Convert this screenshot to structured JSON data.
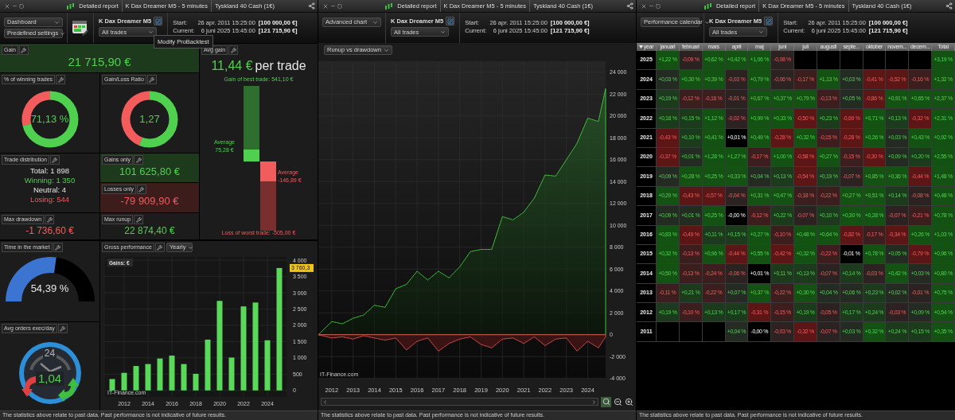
{
  "panels": [
    {
      "tabs": [
        "Detailed report",
        "K Dax Dreamer M5 - 5 minutes",
        "Tyskland 40 Cash (1€)"
      ],
      "view_select": "Dashboard",
      "settings_select": "Predefined settings",
      "system_name": "K Dax Dreamer M5",
      "trades_select": "All trades",
      "start_label": "Start:",
      "start_date": "26 apr. 2011 15:25:00",
      "start_capital": "[100 000,00 €]",
      "current_label": "Current:",
      "current_date": "6 juni 2025 15:45:00",
      "current_capital": "[121 715,90 €]",
      "footer": "The statistics above relate to past data. Past performance is not indicative of future results."
    },
    {
      "tabs": [
        "Detailed report",
        "K Dax Dreamer M5 - 5 minutes",
        "Tyskland 40 Cash (1€)"
      ],
      "view_select": "Advanced chart",
      "system_name": "K Dax Dreamer M5",
      "trades_select": "All trades",
      "start_label": "Start:",
      "start_date": "26 apr. 2011 15:25:00",
      "start_capital": "[100 000,00 €]",
      "current_label": "Current:",
      "current_date": "6 juni 2025 15:45:00",
      "current_capital": "[121 715,90 €]",
      "footer": "The statistics above relate to past data. Past performance is not indicative of future results."
    },
    {
      "tabs": [
        "Detailed report",
        "K Dax Dreamer M5 - 5 minutes",
        "Tyskland 40 Cash (1€)"
      ],
      "view_select": "Performance calendar",
      "system_name": "K Dax Dreamer M5",
      "trades_select": "All trades",
      "start_label": "Start:",
      "start_date": "26 apr. 2011 15:25:00",
      "start_capital": "[100 000,00 €]",
      "current_label": "Current:",
      "current_date": "6 juni 2025 15:45:00",
      "current_capital": "[121 715,90 €]",
      "footer": "The statistics above relate to past data. Past performance is not indicative of future results."
    }
  ],
  "dashboard": {
    "tooltip": "Modify ProBacktest",
    "gain": {
      "title": "Gain",
      "value": "21 715,90 €"
    },
    "avg_gain": {
      "title": "Avg gain",
      "value": "11,44 €",
      "unit": "per trade",
      "best_label": "Gain of best trade: 541,10 €",
      "avg_gain_label": "Average",
      "avg_gain_value": "75,28 €",
      "avg_loss_label": "Average",
      "avg_loss_value": "-146,89 €",
      "worst_label": "Loss of worst trade: -505,00 €"
    },
    "winning": {
      "title": "% of winning trades",
      "value": "71,13 %",
      "level": 0.7113
    },
    "ratio": {
      "title": "Gain/Loss Ratio",
      "value": "1,27",
      "level": 0.56
    },
    "distribution": {
      "title": "Trade distribution",
      "lines": [
        {
          "text": "Total: 1 898",
          "kind": "total"
        },
        {
          "text": "Winning: 1 350",
          "kind": "win"
        },
        {
          "text": "Neutral: 4",
          "kind": "neutral"
        },
        {
          "text": "Losing: 544",
          "kind": "loss"
        }
      ]
    },
    "gains_only": {
      "title": "Gains only",
      "value": "101 625,80 €"
    },
    "losses_only": {
      "title": "Losses only",
      "value": "-79 909,90 €"
    },
    "max_drawdown": {
      "title": "Max drawdown",
      "value": "-1 736,60 €"
    },
    "max_runup": {
      "title": "Max runup",
      "value": "22 874,40 €"
    },
    "time_in_market": {
      "title": "Time in the market",
      "value": "54,39 %",
      "level": 0.5439
    },
    "avg_orders": {
      "title": "Avg orders exec/day",
      "dial": "24",
      "value": "1,04"
    },
    "gross": {
      "title": "Gross performance",
      "period": "Yearly",
      "legend": "Gains: €",
      "marker": "3 760,3",
      "credit": "IT-Finance.com",
      "chart_data": {
        "type": "bar",
        "x": [
          2011,
          2012,
          2013,
          2014,
          2015,
          2016,
          2017,
          2018,
          2019,
          2020,
          2021,
          2022,
          2023,
          2024,
          2025
        ],
        "series": [
          {
            "color": "#5ad85a",
            "values": [
              350,
              540,
              750,
              810,
              980,
              1070,
              810,
              510,
              1560,
              2750,
              1010,
              2580,
              2700,
              1540,
              3760
            ]
          }
        ],
        "ylim": [
          -200,
          4100
        ],
        "xlim": [
          2010.4,
          2025.6
        ],
        "grid": true,
        "xticks": [
          2012,
          2014,
          2016,
          2018,
          2020,
          2022,
          2024
        ],
        "yticks": [
          {
            "value": 0,
            "label": "0"
          },
          {
            "value": 500,
            "label": "500"
          },
          {
            "value": 1000,
            "label": "1 000"
          },
          {
            "value": 1500,
            "label": "1 500"
          },
          {
            "value": 2000,
            "label": "2 000"
          },
          {
            "value": 2500,
            "label": "2 500"
          },
          {
            "value": 3000,
            "label": "3 000"
          },
          {
            "value": 3500,
            "label": "3 500"
          },
          {
            "value": 4000,
            "label": "4 000"
          }
        ]
      }
    }
  },
  "advanced_chart": {
    "chart_select": "Runup vs drawdown",
    "credit": "IT-Finance.com",
    "chart_data": {
      "type": "area",
      "x": [
        2011.37,
        2012,
        2012.5,
        2013,
        2013.5,
        2014,
        2014.5,
        2015,
        2015.5,
        2016,
        2016.5,
        2017,
        2017.5,
        2018,
        2018.5,
        2019,
        2019.5,
        2020,
        2020.5,
        2021,
        2021.5,
        2022,
        2022.5,
        2023,
        2023.5,
        2024,
        2024.5,
        2024.84
      ],
      "series": [
        {
          "color": "#3fbf3f",
          "values": [
            0,
            1200,
            1000,
            1500,
            1800,
            2700,
            2500,
            4200,
            4600,
            5800,
            5000,
            5800,
            5200,
            6200,
            7600,
            7800,
            7800,
            10800,
            10500,
            11200,
            12500,
            14600,
            14500,
            16000,
            17500,
            19800,
            19500,
            22500
          ]
        },
        {
          "color": "#d94a4a",
          "values": [
            0,
            -300,
            -200,
            -400,
            -100,
            -300,
            -500,
            -300,
            -1400,
            -600,
            -300,
            -1500,
            -800,
            -400,
            -200,
            -900,
            -1200,
            -400,
            -300,
            -800,
            -200,
            -1000,
            -400,
            -300,
            -1500,
            -600,
            -1200,
            -200
          ]
        }
      ],
      "xlim": [
        2011.37,
        2024.84
      ],
      "ylim": [
        -4000,
        25000
      ],
      "grid": true,
      "xticks": [
        2012,
        2013,
        2014,
        2015,
        2016,
        2017,
        2018,
        2019,
        2020,
        2021,
        2022,
        2023,
        2024
      ],
      "yticks": [
        {
          "value": -4000,
          "label": "-4 000"
        },
        {
          "value": -2000,
          "label": "-2 000"
        },
        {
          "value": 0,
          "label": "0"
        },
        {
          "value": 2000,
          "label": "2 000"
        },
        {
          "value": 4000,
          "label": "4 000"
        },
        {
          "value": 6000,
          "label": "6 000"
        },
        {
          "value": 8000,
          "label": "8 000"
        },
        {
          "value": 10000,
          "label": "10 000"
        },
        {
          "value": 12000,
          "label": "12 000"
        },
        {
          "value": 14000,
          "label": "14 000"
        },
        {
          "value": 16000,
          "label": "16 000"
        },
        {
          "value": 18000,
          "label": "18 000"
        },
        {
          "value": 20000,
          "label": "20 000"
        },
        {
          "value": 22000,
          "label": "22 000"
        },
        {
          "value": 24000,
          "label": "24 000"
        }
      ]
    }
  },
  "calendar": {
    "columns": [
      "year",
      "januari",
      "februari",
      "mars",
      "april",
      "maj",
      "juni",
      "juli",
      "augusti",
      "septe...",
      "oktober",
      "novem...",
      "decem...",
      "Total"
    ],
    "rows": [
      {
        "cells": [
          {
            "text": "2025"
          },
          {
            "text": "+1,22 %",
            "color": "#145214"
          },
          {
            "text": "-0,09 %",
            "color": "#2c2222"
          },
          {
            "text": "+0,62 %",
            "color": "#145214"
          },
          {
            "text": "+0,42 %",
            "color": "#145214"
          },
          {
            "text": "+1,06 %",
            "color": "#145214"
          },
          {
            "text": "-0,08 %",
            "color": "#2c2222"
          },
          {
            "color": "#000000"
          },
          {
            "color": "#000000"
          },
          {
            "color": "#000000"
          },
          {
            "color": "#000000"
          },
          {
            "color": "#000000"
          },
          {
            "color": "#000000"
          },
          {
            "text": "+3,19 %",
            "color": "#145214"
          }
        ]
      },
      {
        "cells": [
          {
            "text": "2024"
          },
          {
            "text": "+0,03 %",
            "color": "#232b23"
          },
          {
            "text": "+0,30 %",
            "color": "#145214"
          },
          {
            "text": "+0,39 %",
            "color": "#145214"
          },
          {
            "text": "-0,03 %",
            "color": "#2c2222"
          },
          {
            "text": "+0,79 %",
            "color": "#145214"
          },
          {
            "text": "-0,06 %",
            "color": "#2c2222"
          },
          {
            "text": "-0,17 %",
            "color": "#3d1e1e"
          },
          {
            "text": "+1,13 %",
            "color": "#145214"
          },
          {
            "text": "+0,03 %",
            "color": "#232b23"
          },
          {
            "text": "-0,41 %",
            "color": "#5c1616"
          },
          {
            "text": "-0,52 %",
            "color": "#5c1616"
          },
          {
            "text": "-0,16 %",
            "color": "#3d1e1e"
          },
          {
            "text": "+1,32 %",
            "color": "#145214"
          }
        ]
      },
      {
        "cells": [
          {
            "text": "2023"
          },
          {
            "text": "+0,19 %",
            "color": "#1c3a1c"
          },
          {
            "text": "-0,12 %",
            "color": "#3d1e1e"
          },
          {
            "text": "-0,16 %",
            "color": "#3d1e1e"
          },
          {
            "text": "-0,01 %",
            "color": "#2c2222"
          },
          {
            "text": "+0,67 %",
            "color": "#145214"
          },
          {
            "text": "+0,37 %",
            "color": "#145214"
          },
          {
            "text": "+0,79 %",
            "color": "#145214"
          },
          {
            "text": "-0,13 %",
            "color": "#3d1e1e"
          },
          {
            "text": "+0,05 %",
            "color": "#232b23"
          },
          {
            "text": "-0,86 %",
            "color": "#5c1616"
          },
          {
            "text": "+0,91 %",
            "color": "#145214"
          },
          {
            "text": "+0,65 %",
            "color": "#145214"
          },
          {
            "text": "+2,37 %",
            "color": "#145214"
          }
        ]
      },
      {
        "cells": [
          {
            "text": "2022"
          },
          {
            "text": "+0,18 %",
            "color": "#1c3a1c"
          },
          {
            "text": "+0,15 %",
            "color": "#1c3a1c"
          },
          {
            "text": "+1,12 %",
            "color": "#145214"
          },
          {
            "text": "-0,02 %",
            "color": "#2c2222"
          },
          {
            "text": "+0,99 %",
            "color": "#145214"
          },
          {
            "text": "+0,33 %",
            "color": "#145214"
          },
          {
            "text": "-0,50 %",
            "color": "#5c1616"
          },
          {
            "text": "+0,23 %",
            "color": "#1c3a1c"
          },
          {
            "text": "-0,69 %",
            "color": "#5c1616"
          },
          {
            "text": "+0,71 %",
            "color": "#145214"
          },
          {
            "text": "+0,13 %",
            "color": "#1c3a1c"
          },
          {
            "text": "-0,32 %",
            "color": "#5c1616"
          },
          {
            "text": "+2,31 %",
            "color": "#145214"
          }
        ]
      },
      {
        "cells": [
          {
            "text": "2021"
          },
          {
            "text": "-0,43 %",
            "color": "#5c1616"
          },
          {
            "text": "+0,10 %",
            "color": "#1c3a1c"
          },
          {
            "text": "+0,41 %",
            "color": "#145214"
          },
          {
            "text": "+0,01 %",
            "color": "#000000"
          },
          {
            "text": "+0,49 %",
            "color": "#145214"
          },
          {
            "text": "-0,28 %",
            "color": "#5c1616"
          },
          {
            "text": "+0,32 %",
            "color": "#145214"
          },
          {
            "text": "-0,15 %",
            "color": "#3d1e1e"
          },
          {
            "text": "-0,28 %",
            "color": "#5c1616"
          },
          {
            "text": "+0,26 %",
            "color": "#145214"
          },
          {
            "text": "+0,03 %",
            "color": "#232b23"
          },
          {
            "text": "+0,43 %",
            "color": "#145214"
          },
          {
            "text": "+0,92 %",
            "color": "#145214"
          }
        ]
      },
      {
        "cells": [
          {
            "text": "2020"
          },
          {
            "text": "-0,37 %",
            "color": "#5c1616"
          },
          {
            "text": "+0,01 %",
            "color": "#232b23"
          },
          {
            "text": "+1,28 %",
            "color": "#145214"
          },
          {
            "text": "+1,27 %",
            "color": "#145214"
          },
          {
            "text": "-0,17 %",
            "color": "#3d1e1e"
          },
          {
            "text": "+1,00 %",
            "color": "#145214"
          },
          {
            "text": "-0,58 %",
            "color": "#5c1616"
          },
          {
            "text": "+0,27 %",
            "color": "#145214"
          },
          {
            "text": "-0,15 %",
            "color": "#3d1e1e"
          },
          {
            "text": "-0,30 %",
            "color": "#5c1616"
          },
          {
            "text": "+0,09 %",
            "color": "#232b23"
          },
          {
            "text": "+0,20 %",
            "color": "#1c3a1c"
          },
          {
            "text": "+2,55 %",
            "color": "#145214"
          }
        ]
      },
      {
        "cells": [
          {
            "text": "2019"
          },
          {
            "text": "+0,09 %",
            "color": "#232b23"
          },
          {
            "text": "+0,28 %",
            "color": "#145214"
          },
          {
            "text": "+0,25 %",
            "color": "#145214"
          },
          {
            "text": "+0,33 %",
            "color": "#145214"
          },
          {
            "text": "+0,04 %",
            "color": "#232b23"
          },
          {
            "text": "+0,13 %",
            "color": "#1c3a1c"
          },
          {
            "text": "-0,54 %",
            "color": "#5c1616"
          },
          {
            "text": "+0,19 %",
            "color": "#1c3a1c"
          },
          {
            "text": "-0,07 %",
            "color": "#2c2222"
          },
          {
            "text": "+0,85 %",
            "color": "#145214"
          },
          {
            "text": "+0,36 %",
            "color": "#145214"
          },
          {
            "text": "-0,44 %",
            "color": "#5c1616"
          },
          {
            "text": "+1,48 %",
            "color": "#145214"
          }
        ]
      },
      {
        "cells": [
          {
            "text": "2018"
          },
          {
            "text": "+0,29 %",
            "color": "#145214"
          },
          {
            "text": "-0,43 %",
            "color": "#5c1616"
          },
          {
            "text": "-0,57 %",
            "color": "#5c1616"
          },
          {
            "text": "-0,04 %",
            "color": "#2c2222"
          },
          {
            "text": "+0,31 %",
            "color": "#145214"
          },
          {
            "text": "+0,47 %",
            "color": "#145214"
          },
          {
            "text": "-0,18 %",
            "color": "#3d1e1e"
          },
          {
            "text": "-0,22 %",
            "color": "#3d1e1e"
          },
          {
            "text": "+0,27 %",
            "color": "#145214"
          },
          {
            "text": "+0,51 %",
            "color": "#145214"
          },
          {
            "text": "+0,14 %",
            "color": "#1c3a1c"
          },
          {
            "text": "-0,08 %",
            "color": "#2c2222"
          },
          {
            "text": "+0,48 %",
            "color": "#145214"
          }
        ]
      },
      {
        "cells": [
          {
            "text": "2017"
          },
          {
            "text": "+0,09 %",
            "color": "#232b23"
          },
          {
            "text": "+0,01 %",
            "color": "#232b23"
          },
          {
            "text": "+0,25 %",
            "color": "#145214"
          },
          {
            "text": "-0,00 %",
            "color": "#000000"
          },
          {
            "text": "-0,12 %",
            "color": "#3d1e1e"
          },
          {
            "text": "+0,22 %",
            "color": "#1c3a1c"
          },
          {
            "text": "-0,07 %",
            "color": "#2c2222"
          },
          {
            "text": "+0,10 %",
            "color": "#1c3a1c"
          },
          {
            "text": "+0,30 %",
            "color": "#145214"
          },
          {
            "text": "+0,28 %",
            "color": "#145214"
          },
          {
            "text": "-0,07 %",
            "color": "#2c2222"
          },
          {
            "text": "-0,21 %",
            "color": "#3d1e1e"
          },
          {
            "text": "+0,78 %",
            "color": "#145214"
          }
        ]
      },
      {
        "cells": [
          {
            "text": "2016"
          },
          {
            "text": "+0,83 %",
            "color": "#145214"
          },
          {
            "text": "-0,49 %",
            "color": "#5c1616"
          },
          {
            "text": "+0,11 %",
            "color": "#1c3a1c"
          },
          {
            "text": "+0,15 %",
            "color": "#1c3a1c"
          },
          {
            "text": "+0,27 %",
            "color": "#145214"
          },
          {
            "text": "-0,10 %",
            "color": "#3d1e1e"
          },
          {
            "text": "+0,48 %",
            "color": "#145214"
          },
          {
            "text": "+0,64 %",
            "color": "#145214"
          },
          {
            "text": "-0,82 %",
            "color": "#5c1616"
          },
          {
            "text": "-0,17 %",
            "color": "#3d1e1e"
          },
          {
            "text": "-0,34 %",
            "color": "#5c1616"
          },
          {
            "text": "+0,26 %",
            "color": "#145214"
          },
          {
            "text": "+1,03 %",
            "color": "#145214"
          }
        ]
      },
      {
        "cells": [
          {
            "text": "2015"
          },
          {
            "text": "+0,32 %",
            "color": "#145214"
          },
          {
            "text": "-0,13 %",
            "color": "#3d1e1e"
          },
          {
            "text": "+0,96 %",
            "color": "#145214"
          },
          {
            "text": "-0,44 %",
            "color": "#5c1616"
          },
          {
            "text": "+0,55 %",
            "color": "#145214"
          },
          {
            "text": "-0,42 %",
            "color": "#5c1616"
          },
          {
            "text": "+0,32 %",
            "color": "#145214"
          },
          {
            "text": "-0,22 %",
            "color": "#3d1e1e"
          },
          {
            "text": "-0,01 %",
            "color": "#000000"
          },
          {
            "text": "+0,78 %",
            "color": "#145214"
          },
          {
            "text": "+0,05 %",
            "color": "#232b23"
          },
          {
            "text": "-0,79 %",
            "color": "#5c1616"
          },
          {
            "text": "+0,96 %",
            "color": "#145214"
          }
        ]
      },
      {
        "cells": [
          {
            "text": "2014"
          },
          {
            "text": "+0,50 %",
            "color": "#145214"
          },
          {
            "text": "-0,13 %",
            "color": "#3d1e1e"
          },
          {
            "text": "-0,24 %",
            "color": "#3d1e1e"
          },
          {
            "text": "-0,06 %",
            "color": "#2c2222"
          },
          {
            "text": "+0,01 %",
            "color": "#000000"
          },
          {
            "text": "+0,11 %",
            "color": "#1c3a1c"
          },
          {
            "text": "+0,13 %",
            "color": "#1c3a1c"
          },
          {
            "text": "-0,07 %",
            "color": "#2c2222"
          },
          {
            "text": "+0,14 %",
            "color": "#1c3a1c"
          },
          {
            "text": "-0,03 %",
            "color": "#2c2222"
          },
          {
            "text": "+0,42 %",
            "color": "#145214"
          },
          {
            "text": "+0,03 %",
            "color": "#232b23"
          },
          {
            "text": "+0,80 %",
            "color": "#145214"
          }
        ]
      },
      {
        "cells": [
          {
            "text": "2013"
          },
          {
            "text": "-0,11 %",
            "color": "#3d1e1e"
          },
          {
            "text": "+0,21 %",
            "color": "#1c3a1c"
          },
          {
            "text": "-0,22 %",
            "color": "#3d1e1e"
          },
          {
            "text": "+0,07 %",
            "color": "#232b23"
          },
          {
            "text": "+0,37 %",
            "color": "#145214"
          },
          {
            "text": "-0,22 %",
            "color": "#3d1e1e"
          },
          {
            "text": "+0,30 %",
            "color": "#145214"
          },
          {
            "text": "+0,04 %",
            "color": "#232b23"
          },
          {
            "text": "+0,06 %",
            "color": "#232b23"
          },
          {
            "text": "+0,23 %",
            "color": "#1c3a1c"
          },
          {
            "text": "+0,02 %",
            "color": "#232b23"
          },
          {
            "text": "-0,01 %",
            "color": "#2c2222"
          },
          {
            "text": "+0,75 %",
            "color": "#145214"
          }
        ]
      },
      {
        "cells": [
          {
            "text": "2012"
          },
          {
            "text": "+0,19 %",
            "color": "#1c3a1c"
          },
          {
            "text": "-0,10 %",
            "color": "#3d1e1e"
          },
          {
            "text": "+0,13 %",
            "color": "#1c3a1c"
          },
          {
            "text": "+0,17 %",
            "color": "#1c3a1c"
          },
          {
            "text": "-0,31 %",
            "color": "#5c1616"
          },
          {
            "text": "-0,15 %",
            "color": "#3d1e1e"
          },
          {
            "text": "+0,19 %",
            "color": "#1c3a1c"
          },
          {
            "text": "-0,05 %",
            "color": "#2c2222"
          },
          {
            "text": "+0,17 %",
            "color": "#1c3a1c"
          },
          {
            "text": "+0,24 %",
            "color": "#1c3a1c"
          },
          {
            "text": "-0,03 %",
            "color": "#2c2222"
          },
          {
            "text": "+0,09 %",
            "color": "#232b23"
          },
          {
            "text": "+0,54 %",
            "color": "#145214"
          }
        ]
      },
      {
        "cells": [
          {
            "text": "2011"
          },
          {
            "color": "#000000"
          },
          {
            "color": "#000000"
          },
          {
            "color": "#000000"
          },
          {
            "text": "+0,04 %",
            "color": "#232b23"
          },
          {
            "text": "-0,00 %",
            "color": "#000000"
          },
          {
            "text": "-0,03 %",
            "color": "#2c2222"
          },
          {
            "text": "-0,32 %",
            "color": "#5c1616"
          },
          {
            "text": "-0,07 %",
            "color": "#2c2222"
          },
          {
            "text": "+0,03 %",
            "color": "#232b23"
          },
          {
            "text": "+0,32 %",
            "color": "#145214"
          },
          {
            "text": "+0,24 %",
            "color": "#1c3a1c"
          },
          {
            "text": "+0,15 %",
            "color": "#1c3a1c"
          },
          {
            "text": "+0,35 %",
            "color": "#145214"
          }
        ]
      }
    ]
  }
}
